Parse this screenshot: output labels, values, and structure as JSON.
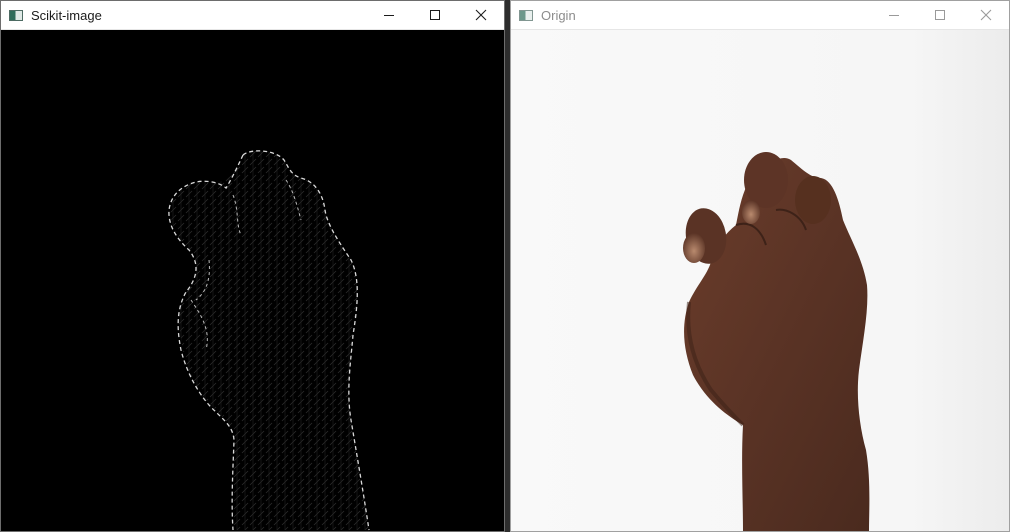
{
  "windows": {
    "left": {
      "title": "Scikit-image",
      "controls": {
        "minimize": "minimize-icon",
        "maximize": "maximize-icon",
        "close": "close-icon"
      },
      "active": true
    },
    "right": {
      "title": "Origin",
      "controls": {
        "minimize": "minimize-icon",
        "maximize": "maximize-icon",
        "close": "close-icon"
      },
      "active": false
    }
  },
  "colors": {
    "hog_background": "#000000",
    "hog_edges": "#d9d9d9",
    "photo_background": "#f8f8f8",
    "skin": "#5a3325"
  }
}
